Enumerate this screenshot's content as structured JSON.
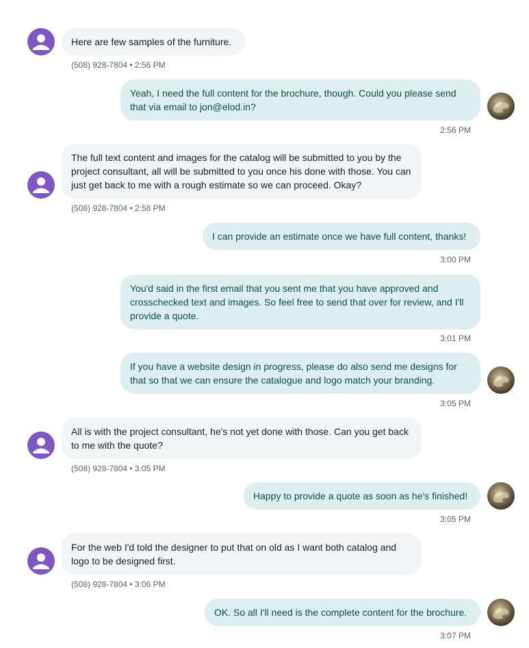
{
  "conversation": {
    "messages": [
      {
        "dir": "in",
        "text": "Here are few samples of the furniture.",
        "meta": "(508) 928-7804 • 2:56 PM"
      },
      {
        "dir": "out",
        "text": "Yeah, I need the full content for the brochure, though. Could you please send that via email to jon@elod.in?",
        "meta": "2:56 PM"
      },
      {
        "dir": "in",
        "text": "The full text content and images for the catalog will be submitted to you by the project consultant, all will be submitted to you once his done with those. You can just get back to me with a rough estimate so we can proceed. Okay?",
        "meta": "(508) 928-7804 • 2:58 PM"
      },
      {
        "dir": "out",
        "text": "I can provide an estimate once we have full content, thanks!",
        "meta": "3:00 PM"
      },
      {
        "dir": "out",
        "text": "You'd said in the first email that you sent me that you have approved and crosschecked text and images. So feel free to send that over for review, and I'll provide a quote.",
        "meta": "3:01 PM"
      },
      {
        "dir": "out",
        "text": "If you have a website design in progress, please do also send me designs for that so that we can ensure the catalogue and logo match your branding.",
        "meta": "3:05 PM"
      },
      {
        "dir": "in",
        "text": "All is with the project consultant, he's not yet done with those. Can you get back to me with the quote?",
        "meta": "(508) 928-7804 • 3:05 PM"
      },
      {
        "dir": "out",
        "text": "Happy to provide a quote as soon as he's finished!",
        "meta": "3:05 PM"
      },
      {
        "dir": "in",
        "text": "For the web I'd told the designer to put that on old as I want both catalog and logo to be designed first.",
        "meta": "(508) 928-7804 • 3:06 PM"
      },
      {
        "dir": "out",
        "text": "OK. So all I'll need is the complete content for the brochure.",
        "meta": "3:07 PM"
      }
    ]
  },
  "colors": {
    "incoming_bubble": "#f1f3f4",
    "outgoing_bubble": "#dcefee",
    "outgoing_text": "#0d4d4a",
    "avatar_purple": "#7e57c2"
  },
  "icons": {
    "contact_avatar": "person-icon",
    "user_avatar": "user-photo-avatar"
  }
}
